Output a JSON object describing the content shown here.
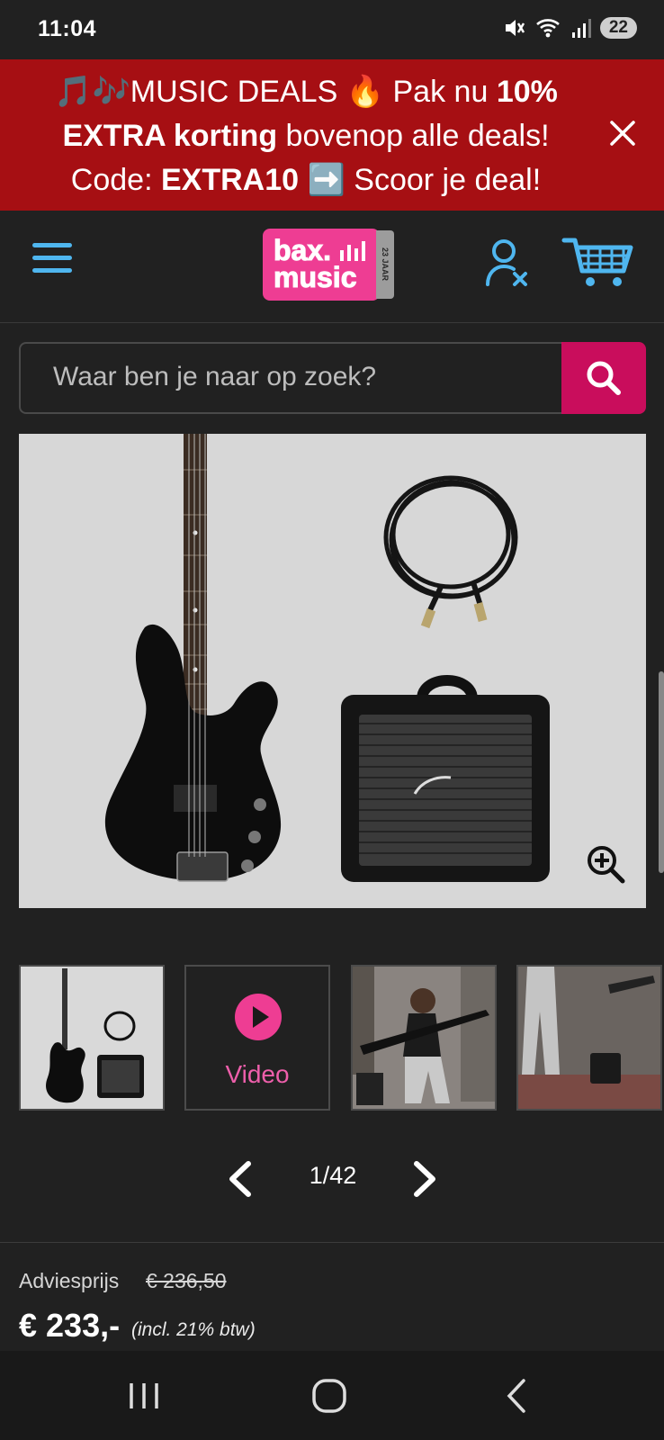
{
  "status_bar": {
    "time": "11:04",
    "battery": "22"
  },
  "promo": {
    "line1_prefix": "🎵🎶MUSIC DEALS 🔥 Pak nu ",
    "line1_bold": "10%",
    "line2_bold": "EXTRA korting",
    "line2_rest": " bovenop alle deals!",
    "line3_prefix": "Code: ",
    "line3_bold": "EXTRA10",
    "line3_rest": " ➡️ Scoor je deal!"
  },
  "header": {
    "logo_line1": "bax.",
    "logo_line2": "music",
    "logo_badge": "23 JAAR"
  },
  "search": {
    "placeholder": "Waar ben je naar op zoek?"
  },
  "gallery": {
    "video_label": "Video",
    "counter": "1/42"
  },
  "pricing": {
    "advies_label": "Adviesprijs",
    "advies_price": "€ 236,50",
    "price": "€ 233,-",
    "btw_note": "(incl. 21% btw)"
  },
  "colors": {
    "promo_bg": "#a60f13",
    "brand_pink": "#ee3d93",
    "search_button": "#c90d5c",
    "icon_blue": "#4fb6ef"
  }
}
